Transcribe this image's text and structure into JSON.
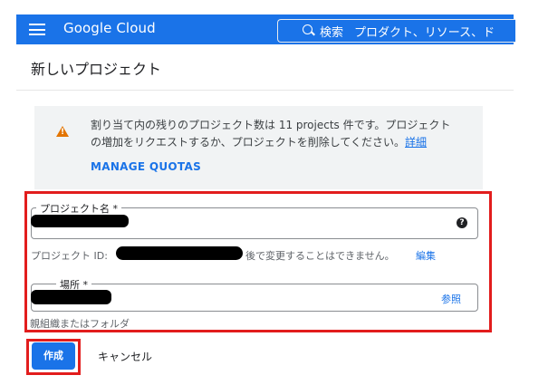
{
  "header": {
    "brand": "Google Cloud",
    "search_label": "検索",
    "search_placeholder": "プロダクト、リソース、ド"
  },
  "page": {
    "title": "新しいプロジェクト"
  },
  "quota": {
    "line1": "割り当て内の残りのプロジェクト数は 11 projects 件です。プロジェクト",
    "line2_prefix": "の増加をリクエストするか、プロジェクトを削除してください。",
    "detail_link": "詳細",
    "manage_link": "MANAGE QUOTAS"
  },
  "form": {
    "project_name_label": "プロジェクト名 *",
    "project_id_label": "プロジェクト ID:",
    "project_id_note": "後で変更することはできません。",
    "edit_link": "編集",
    "location_label": "場所 *",
    "browse_link": "参照",
    "location_hint": "親組織またはフォルダ"
  },
  "actions": {
    "create": "作成",
    "cancel": "キャンセル"
  },
  "icons": {
    "menu": "hamburger-icon",
    "search": "search-icon",
    "warning": "warning-icon",
    "help": "help-icon"
  },
  "colors": {
    "primary": "#1a73e8",
    "warning": "#e37400",
    "highlight": "#e21d1d"
  }
}
